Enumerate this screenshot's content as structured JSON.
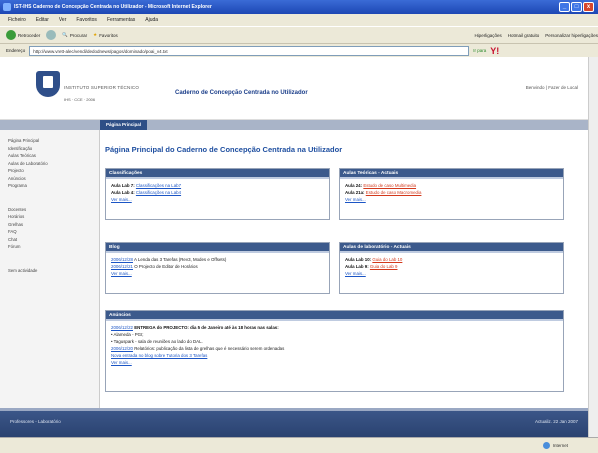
{
  "window": {
    "title": "IST-IHS Caderno de Concepção Centrada no Utilizador - Microsoft Internet Explorer"
  },
  "menu": [
    "Ficheiro",
    "Editar",
    "Ver",
    "Favoritos",
    "Ferramentas",
    "Ajuda"
  ],
  "toolbar": {
    "back": "Retroceder",
    "search": "Procurar",
    "favorites": "Favoritos",
    "links": "Hiperligações",
    "hotmail": "Hotmail gratuito",
    "personalize": "Personalizar hiperligações",
    "yahoo": "Y!"
  },
  "address": {
    "label": "Endereço",
    "url": "http://www.vrett-alec/vendi/dedodnews/pagos/dominado/poai_v4.txt",
    "go": "Ir para"
  },
  "site": {
    "institution": "INSTITUTO SUPERIOR TÉCNICO",
    "institution_sub": "IHS · CCE · 2006",
    "header_title": "Caderno de Concepção Centrada no Utilizador",
    "user": "Benvindo | Fazer de Local",
    "tab": "Página Principal",
    "page_title": "Página Principal do Caderno de Concepção Centrada na Utilizador"
  },
  "sidebar": {
    "group1": [
      "Página Principal",
      "Identificação",
      "Aulas Teóricas",
      "Aulas de Laboratório",
      "Projecto",
      "Anúncios",
      "Programa"
    ],
    "group2": [
      "Docentes",
      "Horários",
      "Grelhas",
      "FAQ",
      "Chat",
      "Fórum"
    ],
    "group3": [
      "Sem actividade"
    ]
  },
  "panels": {
    "classificacoes": {
      "title": "Classificações",
      "rows": [
        {
          "label": "Aula Lab 7:",
          "link": "Classificações na Lab7"
        },
        {
          "label": "Aula Lab 4:",
          "link": "Classificações na Lab4"
        }
      ],
      "more": "Ver mais..."
    },
    "aulas_teoricas": {
      "title": "Aulas Teóricas - Actuais",
      "rows": [
        {
          "label": "Aula 24:",
          "link": "Estudo de caso Multimedia"
        },
        {
          "label": "Aula 21a:",
          "link": "Estudo de caso Macromedia"
        }
      ],
      "more": "Ver mais..."
    },
    "blog": {
      "title": "Blog",
      "rows": [
        {
          "date": "2006/12/28",
          "text": "A Lenda das 3 Tarefas (Rev3, Modes e Offsets)"
        },
        {
          "date": "2006/12/21",
          "text": "O Projecto de Editor de Horários"
        }
      ],
      "more": "Ver mais..."
    },
    "aulas_lab": {
      "title": "Aulas de laboratório - Actuais",
      "rows": [
        {
          "label": "Aula Lab 10:",
          "link": "Guia do Lab 10"
        },
        {
          "label": "Aula Lab 9:",
          "link": "Guia do Lab 9"
        }
      ],
      "more": "Ver mais..."
    },
    "anuncios": {
      "title": "Anúncios",
      "rows": [
        {
          "date": "2006/12/22",
          "text": "ENTREGA do PROJECTO: dia 5 de Janeiro até às 18 horas nas salas:"
        },
        {
          "date": "",
          "text": "• Alameda - PGI;"
        },
        {
          "date": "",
          "text": "• Taguspark - sala de reuniões ao lado do DAL."
        },
        {
          "date": "2006/12/20",
          "text": "Relatórios: publicação da lista de grelhas que é necessário serem ordenadas"
        },
        {
          "date": "",
          "text": "Nova entrada no blog sobre Tutoria dos 3 Tarefas"
        }
      ],
      "more": "Ver mais..."
    }
  },
  "footer": {
    "left": "Professores - Laboratório",
    "right": "Actualiz. 22 Jan 2007"
  },
  "status": {
    "zone": "Internet"
  }
}
